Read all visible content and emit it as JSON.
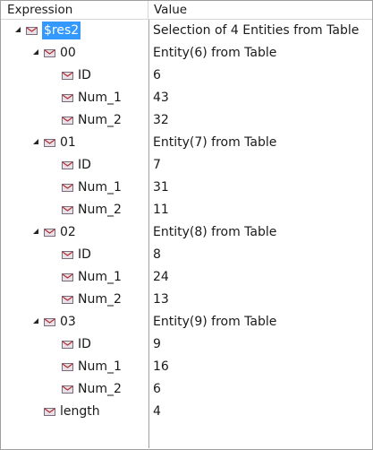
{
  "columns": {
    "expression": "Expression",
    "value": "Value"
  },
  "rows": [
    {
      "name": "$res2",
      "value": "Selection of 4 Entities from Table",
      "level": 0,
      "expandable": true,
      "selected": true
    },
    {
      "name": "00",
      "value": "Entity(6) from Table",
      "level": 1,
      "expandable": true
    },
    {
      "name": "ID",
      "value": "6",
      "level": 2
    },
    {
      "name": "Num_1",
      "value": "43",
      "level": 2
    },
    {
      "name": "Num_2",
      "value": "32",
      "level": 2
    },
    {
      "name": "01",
      "value": "Entity(7) from Table",
      "level": 1,
      "expandable": true
    },
    {
      "name": "ID",
      "value": "7",
      "level": 2
    },
    {
      "name": "Num_1",
      "value": "31",
      "level": 2
    },
    {
      "name": "Num_2",
      "value": "11",
      "level": 2
    },
    {
      "name": "02",
      "value": "Entity(8) from Table",
      "level": 1,
      "expandable": true
    },
    {
      "name": "ID",
      "value": "8",
      "level": 2
    },
    {
      "name": "Num_1",
      "value": "24",
      "level": 2
    },
    {
      "name": "Num_2",
      "value": "13",
      "level": 2
    },
    {
      "name": "03",
      "value": "Entity(9) from Table",
      "level": 1,
      "expandable": true
    },
    {
      "name": "ID",
      "value": "9",
      "level": 2
    },
    {
      "name": "Num_1",
      "value": "16",
      "level": 2
    },
    {
      "name": "Num_2",
      "value": "6",
      "level": 2
    },
    {
      "name": "length",
      "value": "4",
      "level": 1
    }
  ],
  "icons": {
    "expander": "expanded-triangle-icon",
    "node": "object-node-icon"
  },
  "colors": {
    "selection": "#3399ff",
    "border": "#a0a0a0",
    "header_sep": "#d6d6d6"
  }
}
